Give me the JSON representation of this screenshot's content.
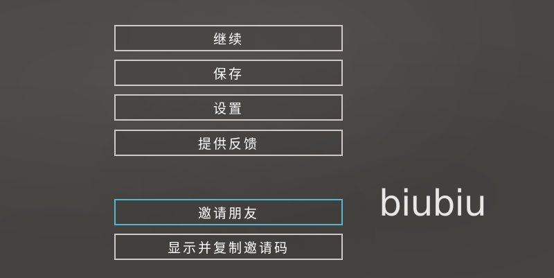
{
  "menu": {
    "continue_label": "继续",
    "save_label": "保存",
    "settings_label": "设置",
    "feedback_label": "提供反馈",
    "invite_label": "邀请朋友",
    "show_code_label": "显示并复制邀请码"
  },
  "logo": {
    "text": "biubiu"
  },
  "colors": {
    "background": "#4a4644",
    "button_border": "#cfcac6",
    "selected_border": "#4fb9d0",
    "text": "#ffffff"
  }
}
